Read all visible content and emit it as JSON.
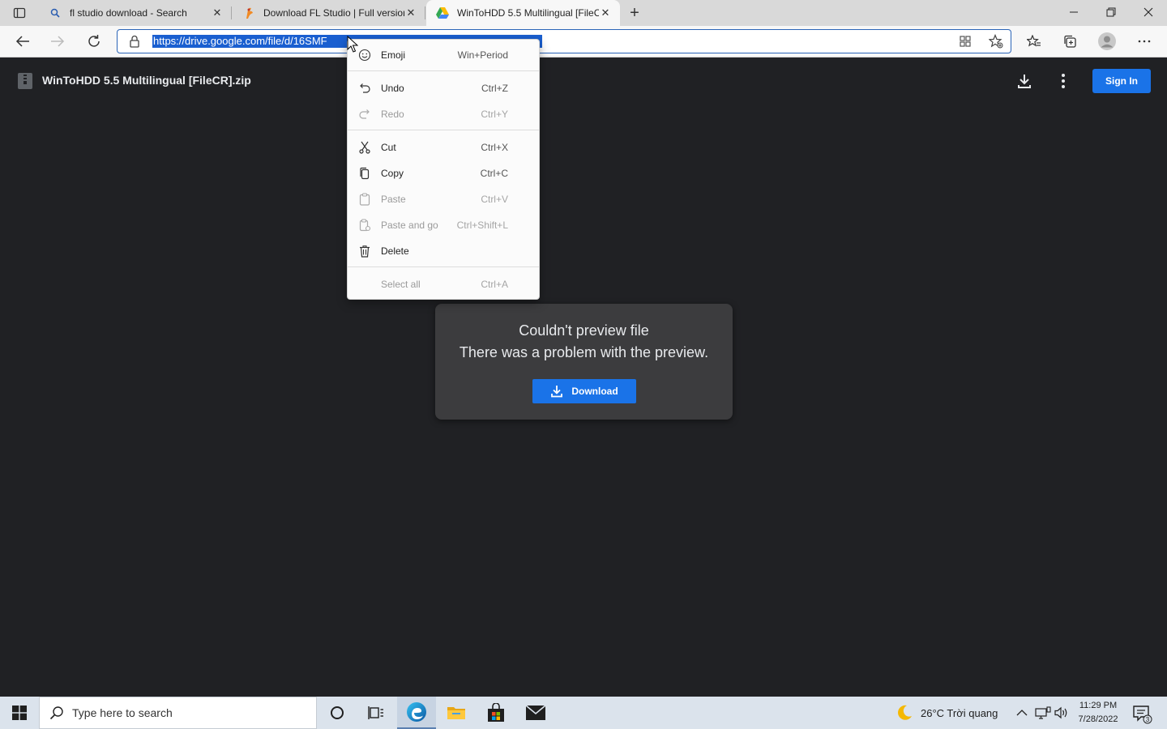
{
  "browser": {
    "tabs": [
      {
        "title": "fl studio download - Search",
        "close": "✕"
      },
      {
        "title": "Download FL Studio | Full version",
        "close": "✕"
      },
      {
        "title": "WinToHDD 5.5 Multilingual [FileC",
        "close": "✕"
      }
    ],
    "new_tab": "+",
    "address_url": "https://drive.google.com/file/d/16SMF"
  },
  "drive": {
    "file_title": "WinToHDD 5.5 Multilingual [FileCR].zip",
    "sign_in": "Sign In",
    "error_title": "Couldn't preview file",
    "error_message": "There was a problem with the preview.",
    "download_label": "Download",
    "accent": "#1a73e8"
  },
  "context_menu": {
    "items": [
      {
        "label": "Emoji",
        "shortcut": "Win+Period",
        "icon": "emoji-icon",
        "enabled": true
      },
      {
        "label": "Undo",
        "shortcut": "Ctrl+Z",
        "icon": "undo-icon",
        "enabled": true
      },
      {
        "label": "Redo",
        "shortcut": "Ctrl+Y",
        "icon": "redo-icon",
        "enabled": false
      },
      {
        "label": "Cut",
        "shortcut": "Ctrl+X",
        "icon": "cut-icon",
        "enabled": true
      },
      {
        "label": "Copy",
        "shortcut": "Ctrl+C",
        "icon": "copy-icon",
        "enabled": true
      },
      {
        "label": "Paste",
        "shortcut": "Ctrl+V",
        "icon": "paste-icon",
        "enabled": false
      },
      {
        "label": "Paste and go",
        "shortcut": "Ctrl+Shift+L",
        "icon": "paste-go-icon",
        "enabled": false
      },
      {
        "label": "Delete",
        "shortcut": "",
        "icon": "delete-icon",
        "enabled": true
      },
      {
        "label": "Select all",
        "shortcut": "Ctrl+A",
        "icon": "",
        "enabled": false
      }
    ]
  },
  "taskbar": {
    "search_placeholder": "Type here to search",
    "weather": "26°C  Trời quang",
    "time": "11:29 PM",
    "date": "7/28/2022",
    "notification_count": "3"
  }
}
